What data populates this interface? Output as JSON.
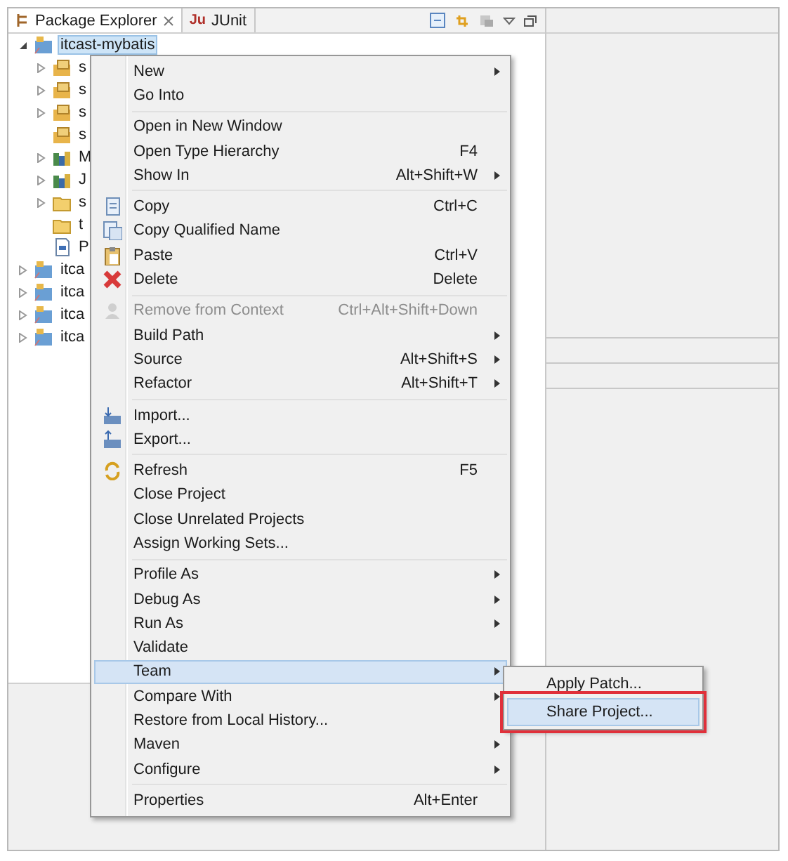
{
  "tabs": [
    {
      "label": "Package Explorer",
      "selected": true,
      "closable": true
    },
    {
      "label": "JUnit",
      "badge": "Ju",
      "selected": false,
      "closable": false
    }
  ],
  "tree": [
    {
      "label": "itcast-mybatis",
      "kind": "project",
      "expanded": true,
      "selected": true,
      "children": [
        {
          "label": "s",
          "kind": "package",
          "expanded": false,
          "selected": false
        },
        {
          "label": "s",
          "kind": "package",
          "expanded": false,
          "selected": false
        },
        {
          "label": "s",
          "kind": "package",
          "expanded": false,
          "selected": false
        },
        {
          "label": "s",
          "kind": "package",
          "selected": false
        },
        {
          "label": "M",
          "kind": "library",
          "expanded": false,
          "selected": false
        },
        {
          "label": "J",
          "kind": "library",
          "expanded": false,
          "selected": false
        },
        {
          "label": "s",
          "kind": "folder",
          "expanded": false,
          "selected": false
        },
        {
          "label": "t",
          "kind": "folder",
          "selected": false
        },
        {
          "label": "P",
          "kind": "file",
          "selected": false
        }
      ]
    },
    {
      "label": "itca",
      "kind": "project",
      "expanded": false,
      "selected": false
    },
    {
      "label": "itca",
      "kind": "project",
      "expanded": false,
      "selected": false
    },
    {
      "label": "itca",
      "kind": "project",
      "expanded": false,
      "selected": false
    },
    {
      "label": "itca",
      "kind": "project",
      "expanded": false,
      "selected": false
    }
  ],
  "context_menu": [
    {
      "kind": "item",
      "label": "New",
      "submenu": true,
      "disabled": false,
      "selected": false
    },
    {
      "kind": "item",
      "label": "Go Into",
      "submenu": false,
      "disabled": false,
      "selected": false
    },
    {
      "kind": "separator"
    },
    {
      "kind": "item",
      "label": "Open in New Window",
      "submenu": false,
      "disabled": false,
      "selected": false
    },
    {
      "kind": "item",
      "label": "Open Type Hierarchy",
      "shortcut": "F4",
      "submenu": false,
      "disabled": false,
      "selected": false
    },
    {
      "kind": "item",
      "label": "Show In",
      "shortcut": "Alt+Shift+W",
      "submenu": true,
      "disabled": false,
      "selected": false
    },
    {
      "kind": "separator"
    },
    {
      "kind": "item",
      "label": "Copy",
      "shortcut": "Ctrl+C",
      "submenu": false,
      "disabled": false,
      "selected": false
    },
    {
      "kind": "item",
      "label": "Copy Qualified Name",
      "submenu": false,
      "disabled": false,
      "selected": false
    },
    {
      "kind": "item",
      "label": "Paste",
      "shortcut": "Ctrl+V",
      "submenu": false,
      "disabled": false,
      "selected": false
    },
    {
      "kind": "item",
      "label": "Delete",
      "shortcut": "Delete",
      "submenu": false,
      "disabled": false,
      "selected": false
    },
    {
      "kind": "separator"
    },
    {
      "kind": "item",
      "label": "Remove from Context",
      "shortcut": "Ctrl+Alt+Shift+Down",
      "submenu": false,
      "disabled": true,
      "selected": false
    },
    {
      "kind": "item",
      "label": "Build Path",
      "submenu": true,
      "disabled": false,
      "selected": false
    },
    {
      "kind": "item",
      "label": "Source",
      "shortcut": "Alt+Shift+S",
      "submenu": true,
      "disabled": false,
      "selected": false
    },
    {
      "kind": "item",
      "label": "Refactor",
      "shortcut": "Alt+Shift+T",
      "submenu": true,
      "disabled": false,
      "selected": false
    },
    {
      "kind": "separator"
    },
    {
      "kind": "item",
      "label": "Import...",
      "submenu": false,
      "disabled": false,
      "selected": false
    },
    {
      "kind": "item",
      "label": "Export...",
      "submenu": false,
      "disabled": false,
      "selected": false
    },
    {
      "kind": "separator"
    },
    {
      "kind": "item",
      "label": "Refresh",
      "shortcut": "F5",
      "submenu": false,
      "disabled": false,
      "selected": false
    },
    {
      "kind": "item",
      "label": "Close Project",
      "submenu": false,
      "disabled": false,
      "selected": false
    },
    {
      "kind": "item",
      "label": "Close Unrelated Projects",
      "submenu": false,
      "disabled": false,
      "selected": false
    },
    {
      "kind": "item",
      "label": "Assign Working Sets...",
      "submenu": false,
      "disabled": false,
      "selected": false
    },
    {
      "kind": "separator"
    },
    {
      "kind": "item",
      "label": "Profile As",
      "submenu": true,
      "disabled": false,
      "selected": false
    },
    {
      "kind": "item",
      "label": "Debug As",
      "submenu": true,
      "disabled": false,
      "selected": false
    },
    {
      "kind": "item",
      "label": "Run As",
      "submenu": true,
      "disabled": false,
      "selected": false
    },
    {
      "kind": "item",
      "label": "Validate",
      "submenu": false,
      "disabled": false,
      "selected": false
    },
    {
      "kind": "item",
      "label": "Team",
      "submenu": true,
      "disabled": false,
      "selected": true
    },
    {
      "kind": "item",
      "label": "Compare With",
      "submenu": true,
      "disabled": false,
      "selected": false
    },
    {
      "kind": "item",
      "label": "Restore from Local History...",
      "submenu": false,
      "disabled": false,
      "selected": false
    },
    {
      "kind": "item",
      "label": "Maven",
      "submenu": true,
      "disabled": false,
      "selected": false
    },
    {
      "kind": "item",
      "label": "Configure",
      "submenu": true,
      "disabled": false,
      "selected": false
    },
    {
      "kind": "separator"
    },
    {
      "kind": "item",
      "label": "Properties",
      "shortcut": "Alt+Enter",
      "submenu": false,
      "disabled": false,
      "selected": false
    }
  ],
  "team_submenu": [
    {
      "label": "Apply Patch...",
      "selected": false,
      "annotated": false
    },
    {
      "label": "Share Project...",
      "selected": true,
      "annotated": true
    }
  ]
}
